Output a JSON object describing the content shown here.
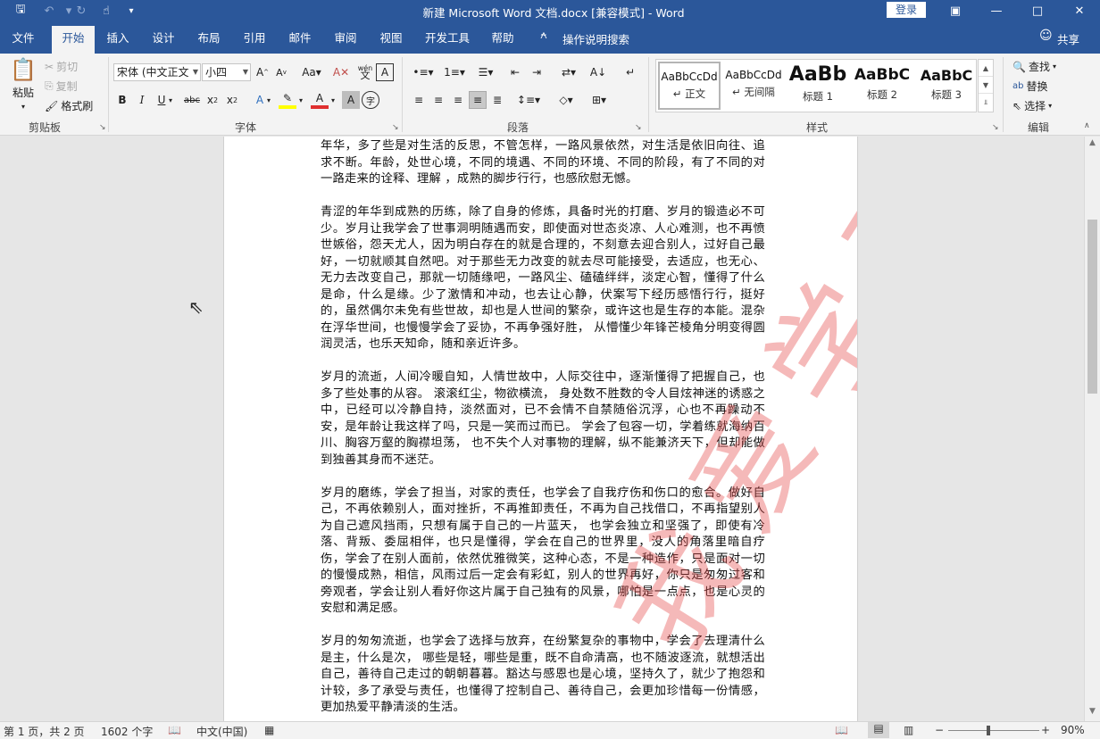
{
  "titlebar": {
    "title": "新建 Microsoft Word 文档.docx [兼容模式] - Word",
    "login": "登录",
    "save_icon": "save-icon",
    "undo_icon": "undo-icon",
    "redo_icon": "redo-icon",
    "touch_icon": "touch-mode-icon",
    "customize_icon": "customize-quick-access-icon"
  },
  "tabs": [
    "文件",
    "开始",
    "插入",
    "设计",
    "布局",
    "引用",
    "邮件",
    "审阅",
    "视图",
    "开发工具",
    "帮助"
  ],
  "tell_me": "操作说明搜索",
  "share": "共享",
  "ribbon": {
    "clipboard": {
      "label": "剪贴板",
      "paste": "粘贴",
      "cut": "剪切",
      "copy": "复制",
      "format_painter": "格式刷"
    },
    "font": {
      "label": "字体",
      "font_name": "宋体 (中文正文",
      "font_size": "小四",
      "phonetic": "wén"
    },
    "paragraph": {
      "label": "段落"
    },
    "styles": {
      "label": "样式",
      "tiles": [
        {
          "sample": "AaBbCcDd",
          "name": "正文"
        },
        {
          "sample": "AaBbCcDd",
          "name": "无间隔"
        },
        {
          "sample": "AaBb",
          "name": "标题 1"
        },
        {
          "sample": "AaBbC",
          "name": "标题 2"
        },
        {
          "sample": "AaBbC",
          "name": "标题 3"
        }
      ]
    },
    "editing": {
      "label": "编辑",
      "find": "查找",
      "replace": "替换",
      "select": "选择"
    }
  },
  "document": {
    "watermark": "我爱学习",
    "paragraphs": [
      "年华，多了些是对生活的反思，不管怎样，一路风景依然，对生活是依旧向往、追求不断。年龄，处世心境，不同的境遇、不同的环境、不同的阶段，有了不同的对一路走来的诠释、理解 ，成熟的脚步行行，也感欣慰无憾。",
      "青涩的年华到成熟的历练，除了自身的修炼，具备时光的打磨、岁月的锻造必不可少。岁月让我学会了世事洞明随遇而安，即使面对世态炎凉、人心难测，也不再愤世嫉俗，怨天尤人，因为明白存在的就是合理的，不刻意去迎合别人，过好自己最好，一切就顺其自然吧。对于那些无力改变的就去尽可能接受，去适应，也无心、无力去改变自己，那就一切随缘吧，一路风尘、磕磕绊绊，淡定心智，懂得了什么是命，什么是缘。少了激情和冲动，也去让心静，伏案写下经历感悟行行，挺好的，虽然偶尔未免有些世故，却也是人世间的繁杂，或许这也是生存的本能。混杂在浮华世间，也慢慢学会了妥协，不再争强好胜， 从懵懂少年锋芒棱角分明变得圆润灵活，也乐天知命，随和亲近许多。",
      "岁月的流逝，人间冷暖自知，人情世故中，人际交往中，逐渐懂得了把握自己，也多了些处事的从容。 滚滚红尘，物欲横流， 身处数不胜数的令人目炫神迷的诱惑之中，已经可以冷静自持，淡然面对，已不会情不自禁随俗沉浮，心也不再躁动不安，是年龄让我这样了吗，只是一笑而过而已。 学会了包容一切，学着练就海纳百川、胸容万壑的胸襟坦荡， 也不失个人对事物的理解，纵不能兼济天下，但却能做到独善其身而不迷茫。",
      "岁月的磨练，学会了担当，对家的责任，也学会了自我疗伤和伤口的愈合。做好自己，不再依赖别人，面对挫折，不再推卸责任，不再为自己找借口，不再指望别人为自己遮风挡雨，只想有属于自己的一片蓝天， 也学会独立和坚强了，即使有冷落、背叛、委屈相伴，也只是懂得，学会在自己的世界里，没人的角落里暗自疗伤，学会了在别人面前，依然优雅微笑，这种心态，不是一种造作，只是面对一切的慢慢成熟，相信，风雨过后一定会有彩虹，别人的世界再好，你只是匆匆过客和旁观者，学会让别人看好你这片属于自己独有的风景，哪怕是一点点，也是心灵的安慰和满足感。",
      "岁月的匆匆流逝，也学会了选择与放弃，在纷繁复杂的事物中，学会了去理清什么是主，什么是次， 哪些是轻，哪些是重，既不自命清高，也不随波逐流，就想活出自己，善待自己走过的朝朝暮暮。豁达与感恩也是心境，坚持久了，就少了抱怨和计较，多了承受与责任，也懂得了控制自己、善待自己，会更加珍惜每一份情感，更加热爱平静清淡的生活。"
    ]
  },
  "status": {
    "page": "第 1 页，共 2 页",
    "words": "1602 个字",
    "language": "中文(中国)",
    "zoom": "90%",
    "zoom_fraction": 0.5
  }
}
